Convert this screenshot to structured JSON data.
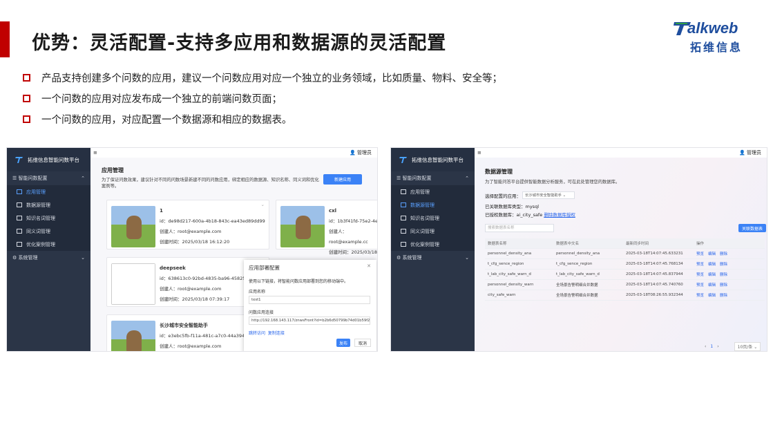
{
  "title": "优势：灵活配置-支持多应用和数据源的灵活配置",
  "logo": {
    "word": "alkweb",
    "cn": "拓维信息"
  },
  "bullets": [
    "产品支持创建多个问数的应用，建议一个问数应用对应一个独立的业务领域，比如质量、物料、安全等；",
    "一个问数的应用对应发布成一个独立的前端问数页面；",
    "一个问数的应用，对应配置一个数据源和相应的数据表。"
  ],
  "app": {
    "brand": "拓维信息智能问数平台",
    "menu_group": "智能问数配置",
    "menu_items": [
      "应用管理",
      "数据源管理",
      "知识名词管理",
      "同义词管理",
      "优化案例管理"
    ],
    "system_menu": "系统管理",
    "user": "管理员"
  },
  "shot1": {
    "header": "应用管理",
    "desc": "为了保证问数效果，建议针对不同的问数场景新建不同的问数应用，绑定相应的数据源、知识名称、同义词和优化案例等。",
    "new_button": "新建应用",
    "cards": [
      {
        "name": "1",
        "id": "id：de98d217-600a-4b18-843c-ea43ed89dd99",
        "creator": "创建人：root@example.com",
        "time": "创建时间：2025/03/18 16:12:20"
      },
      {
        "name": "cxl",
        "id": "id：1b3f41fd-75e2-4e84",
        "creator": "创建人：root@example.cc",
        "time": "创建时间：2025/03/18 0"
      },
      {
        "name": "deepseek",
        "id": "id：638613c0-92bd-4835-ba96-45825235",
        "creator": "创建人：root@example.com",
        "time": "创建时间：2025/03/18 07:39:17"
      },
      {
        "name": "长沙城市安全智能助手",
        "id": "id：e3ebc5fb-f11a-481c-a7c0-44a3945567",
        "creator": "创建人：root@example.com",
        "time": ""
      }
    ],
    "dialog": {
      "title": "应用部署配置",
      "hint": "使用以下链接，将智能问数应用部署到您的移动端中。",
      "name_label": "应用名称",
      "name_value": "test1",
      "link_label": "问数应用连接",
      "link_value": "http://192.168.143.117/znwsFront?id=b2b6d50799b74d01b59f2932ed2c",
      "jump": "跳转访问",
      "copy": "复制连接",
      "publish": "发布",
      "cancel": "取消"
    }
  },
  "shot2": {
    "header": "数据源管理",
    "desc": "为了智能问答平台提供智能数据分析服务，可在此处管理您的数据库。",
    "select_label": "选择配置的应用：",
    "select_value": "长沙城市安全智能助手",
    "db_type": "已关联数据库类型：mysql",
    "auth_label": "已授权数据库：ai_city_safe",
    "auth_link": "删除数据库授权",
    "search_placeholder": "搜索数据表名称",
    "link_button": "关联数据表",
    "columns": [
      "数据表名称",
      "数据表中文名",
      "最新同步时间",
      "操作"
    ],
    "rows": [
      [
        "personnel_density_ana",
        "personnel_density_ana",
        "2025-03-18T14:07:45.633231"
      ],
      [
        "t_cfg_sence_region",
        "t_cfg_sence_region",
        "2025-03-18T14:07:45.768134"
      ],
      [
        "t_lab_city_safe_warn_d",
        "t_lab_city_safe_warn_d",
        "2025-03-18T14:07:45.837944"
      ],
      [
        "personnel_density_warn",
        "全场景告警明细合并数据",
        "2025-03-18T14:07:45.740760"
      ],
      [
        "city_safe_warn",
        "全场景告警明细合并数据",
        "2025-03-18T08:26:55.932344"
      ]
    ],
    "actions": [
      "预览",
      "编辑",
      "删除"
    ],
    "page": "1",
    "page_size": "10页/条"
  }
}
